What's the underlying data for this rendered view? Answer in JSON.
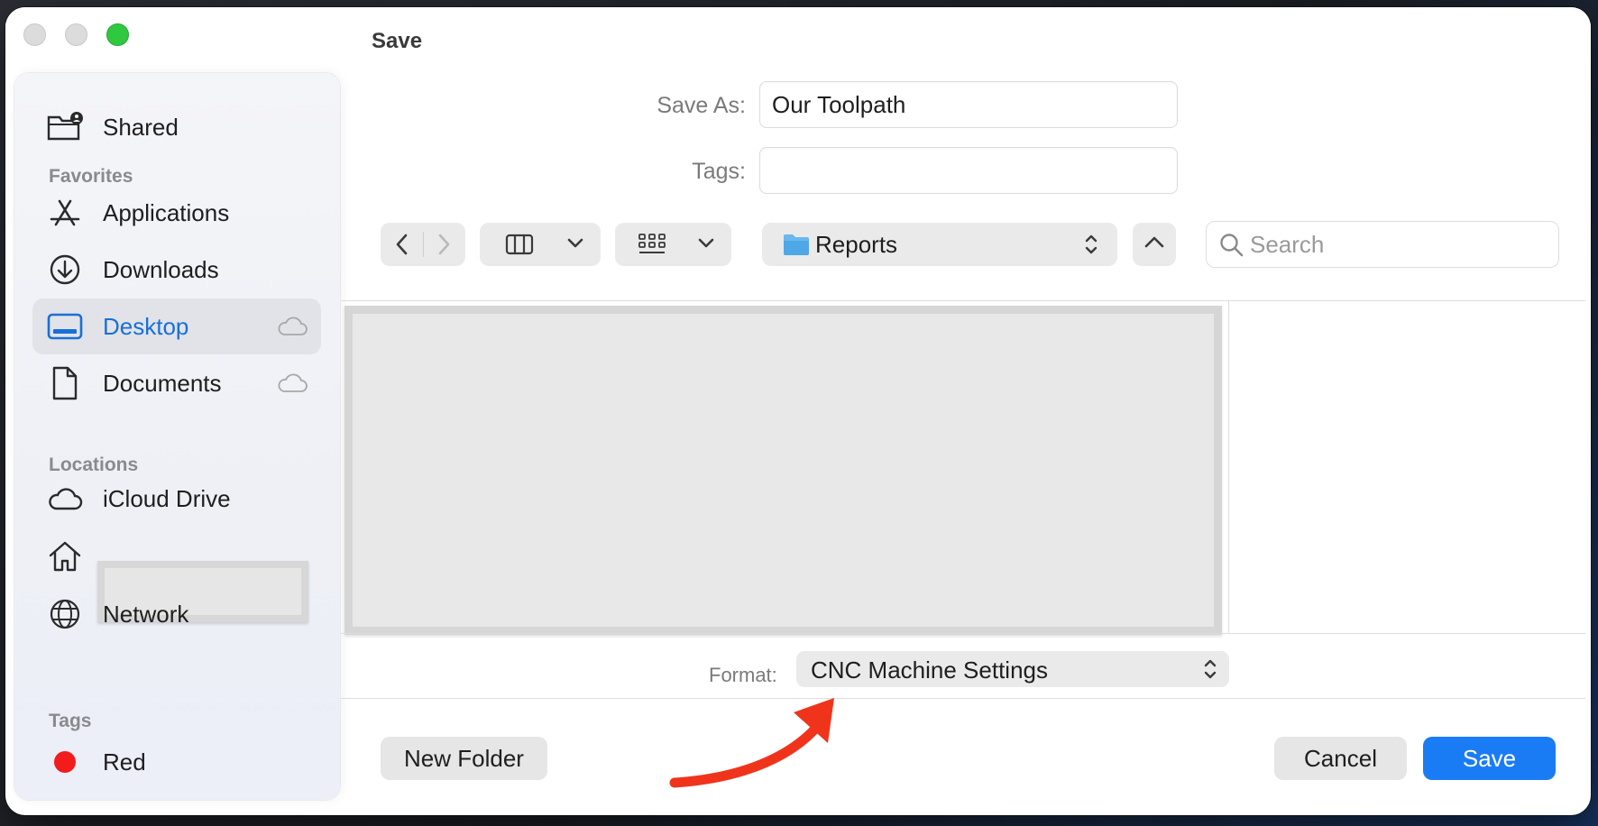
{
  "window": {
    "title": "Save"
  },
  "sidebar": {
    "shared": {
      "label": "Shared",
      "icon": "shared-folder-icon"
    },
    "favorites_heading": "Favorites",
    "favorites": [
      {
        "label": "Applications",
        "icon": "applications-icon"
      },
      {
        "label": "Downloads",
        "icon": "downloads-icon"
      },
      {
        "label": "Desktop",
        "icon": "desktop-icon",
        "selected": true,
        "cloud": true
      },
      {
        "label": "Documents",
        "icon": "document-icon",
        "cloud": true
      }
    ],
    "locations_heading": "Locations",
    "locations": [
      {
        "label": "iCloud Drive",
        "icon": "icloud-icon"
      },
      {
        "label": "",
        "icon": "home-icon"
      },
      {
        "label": "Network",
        "icon": "network-icon"
      }
    ],
    "tags_heading": "Tags",
    "tags": [
      {
        "label": "Red",
        "color": "#f21c1c"
      }
    ]
  },
  "form": {
    "save_as_label": "Save As:",
    "save_as_value": "Our Toolpath",
    "tags_label": "Tags:",
    "tags_value": ""
  },
  "toolbar": {
    "location": "Reports",
    "search_placeholder": "Search"
  },
  "format": {
    "label": "Format:",
    "value": "CNC Machine Settings"
  },
  "buttons": {
    "new_folder": "New Folder",
    "cancel": "Cancel",
    "save": "Save"
  },
  "colors": {
    "accent": "#1a7cf5",
    "annotation_arrow": "#f0341c"
  }
}
